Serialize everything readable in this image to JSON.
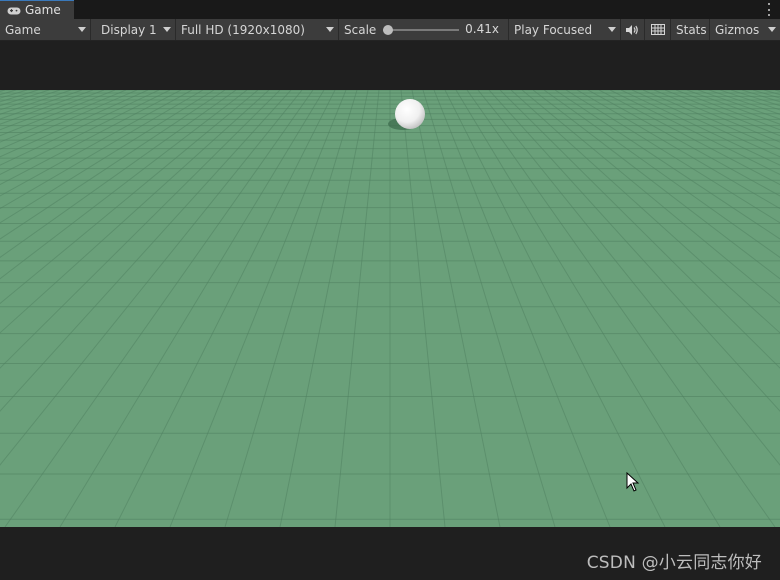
{
  "tab": {
    "label": "Game",
    "icon": "gamepad-icon"
  },
  "toolbar": {
    "mode_label": "Game",
    "display_label": "Display 1",
    "resolution_label": "Full HD (1920x1080)",
    "scale_label": "Scale",
    "scale_value": "0.41x",
    "scale_fraction": 0.0,
    "play_mode_label": "Play Focused",
    "stats_label": "Stats",
    "gizmos_label": "Gizmos"
  },
  "colors": {
    "ground": "#6aa07a",
    "gridline": "#4f8060",
    "tab_accent": "#3a79bb"
  },
  "watermark": {
    "text": "CSDN @小云同志你好"
  }
}
